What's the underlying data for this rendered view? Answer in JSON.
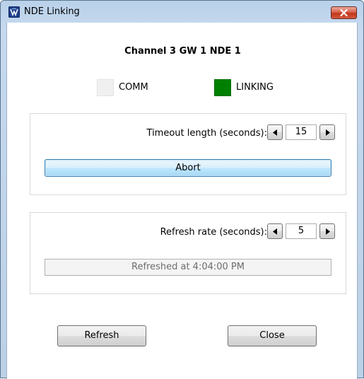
{
  "window": {
    "title": "NDE Linking",
    "app_icon": "nde-app-icon",
    "close_icon": "close-icon"
  },
  "heading": "Channel 3  GW 1  NDE 1",
  "indicators": {
    "comm": {
      "label": "COMM",
      "color": "#f0f0f0",
      "state": "off"
    },
    "linking": {
      "label": "LINKING",
      "color": "#008000",
      "state": "on"
    }
  },
  "timeout": {
    "label": "Timeout length (seconds):",
    "value": "15",
    "decrement_icon": "arrow-left-icon",
    "increment_icon": "arrow-right-icon"
  },
  "abort_label": "Abort",
  "refresh_rate": {
    "label": "Refresh rate (seconds):",
    "value": "5",
    "decrement_icon": "arrow-left-icon",
    "increment_icon": "arrow-right-icon"
  },
  "status_text": "Refreshed at 4:04:00 PM",
  "buttons": {
    "refresh": "Refresh",
    "close": "Close"
  }
}
